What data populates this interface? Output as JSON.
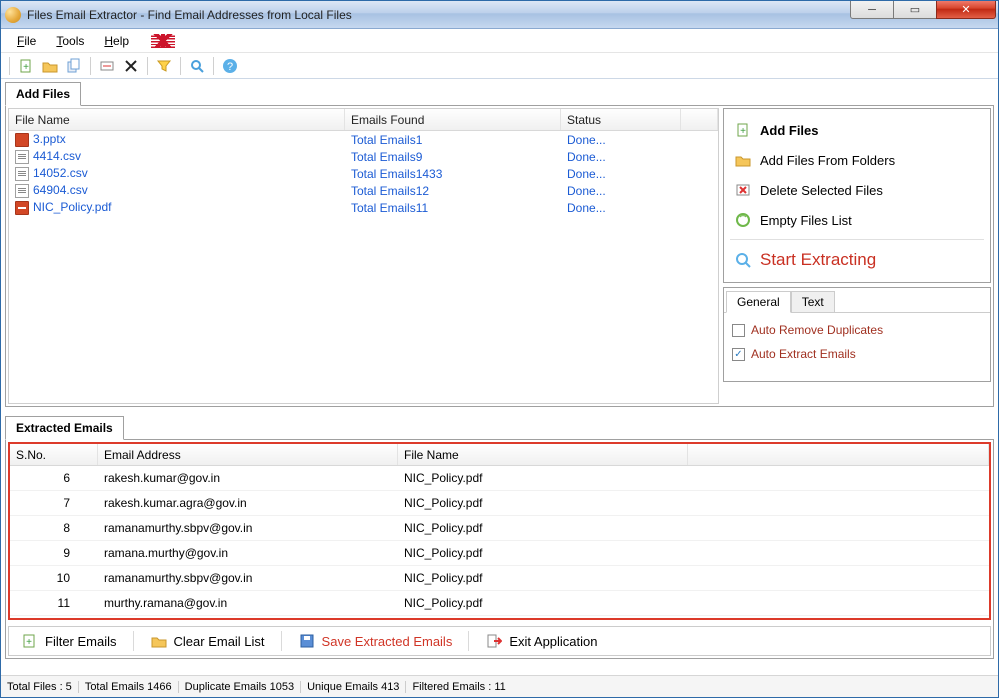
{
  "window": {
    "title": "Files Email Extractor -   Find Email Addresses from Local Files"
  },
  "menu": {
    "file": "File",
    "tools": "Tools",
    "help": "Help"
  },
  "tabs": {
    "add_files": "Add Files",
    "extracted": "Extracted Emails"
  },
  "grid": {
    "headers": {
      "file_name": "File Name",
      "emails_found": "Emails Found",
      "status": "Status"
    },
    "rows": [
      {
        "icon": "pptx",
        "name": "3.pptx",
        "emails": "Total Emails1",
        "status": "Done..."
      },
      {
        "icon": "csv",
        "name": "4414.csv",
        "emails": "Total Emails9",
        "status": "Done..."
      },
      {
        "icon": "csv",
        "name": "14052.csv",
        "emails": "Total Emails1433",
        "status": "Done..."
      },
      {
        "icon": "csv",
        "name": "64904.csv",
        "emails": "Total Emails12",
        "status": "Done..."
      },
      {
        "icon": "pdf",
        "name": "NIC_Policy.pdf",
        "emails": "Total Emails11",
        "status": "Done..."
      }
    ]
  },
  "actions": {
    "add_files": "Add Files",
    "add_from_folders": "Add Files From Folders",
    "delete_selected": "Delete Selected Files",
    "empty_list": "Empty Files List",
    "start_extract": "Start Extracting"
  },
  "options": {
    "tab_general": "General",
    "tab_text": "Text",
    "auto_remove": "Auto Remove Duplicates",
    "auto_extract": "Auto Extract Emails"
  },
  "extracted": {
    "headers": {
      "sno": "S.No.",
      "email": "Email Address",
      "file": "File Name"
    },
    "rows": [
      {
        "sno": "6",
        "email": "rakesh.kumar@gov.in",
        "file": "NIC_Policy.pdf"
      },
      {
        "sno": "7",
        "email": "rakesh.kumar.agra@gov.in",
        "file": "NIC_Policy.pdf"
      },
      {
        "sno": "8",
        "email": "ramanamurthy.sbpv@gov.in",
        "file": "NIC_Policy.pdf"
      },
      {
        "sno": "9",
        "email": "ramana.murthy@gov.in",
        "file": "NIC_Policy.pdf"
      },
      {
        "sno": "10",
        "email": "ramanamurthy.sbpv@gov.in",
        "file": "NIC_Policy.pdf"
      },
      {
        "sno": "11",
        "email": "murthy.ramana@gov.in",
        "file": "NIC_Policy.pdf"
      }
    ]
  },
  "bottom": {
    "filter": "Filter Emails",
    "clear": "Clear Email List",
    "save": "Save Extracted Emails",
    "exit": "Exit Application"
  },
  "status": {
    "total_files": "Total Files :  5",
    "total_emails": "Total Emails  1466",
    "dup": "Duplicate Emails  1053",
    "unique": "Unique Emails  413",
    "filtered": "Filtered Emails :  11"
  }
}
